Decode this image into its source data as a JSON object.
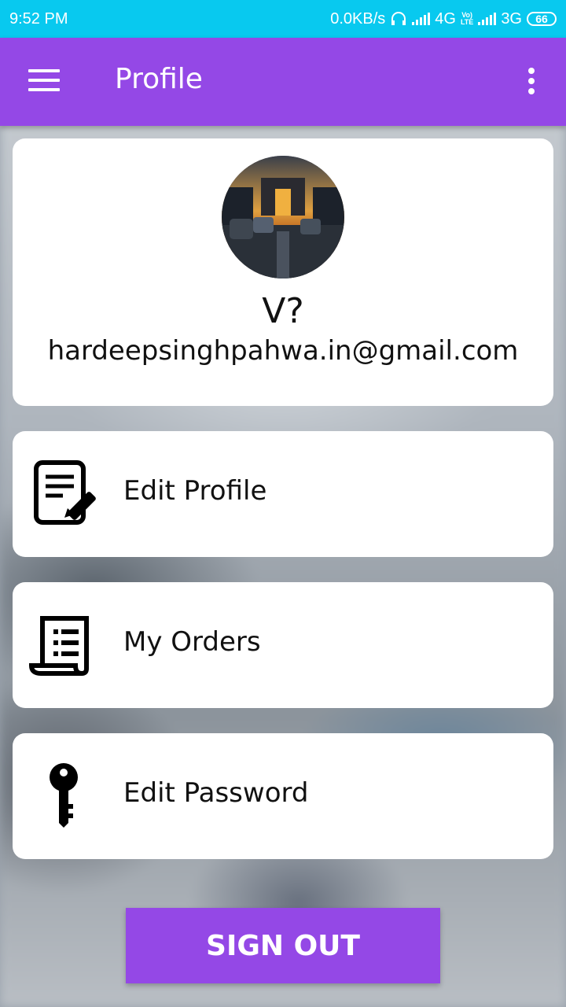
{
  "status_bar": {
    "time": "9:52 PM",
    "net_speed": "0.0KB/s",
    "network1": "4G",
    "volte_top": "Vo)",
    "volte_bottom": "LTE",
    "network2": "3G",
    "battery": "66"
  },
  "app_bar": {
    "title": "Profile",
    "menu_icon": "hamburger-menu-icon",
    "overflow_icon": "more-vert-icon"
  },
  "profile": {
    "name": "V?",
    "email": "hardeepsinghpahwa.in@gmail.com"
  },
  "menu": [
    {
      "label": "Edit Profile",
      "icon": "edit-document-icon"
    },
    {
      "label": "My Orders",
      "icon": "receipt-list-icon"
    },
    {
      "label": "Edit Password",
      "icon": "key-icon"
    }
  ],
  "sign_out_label": "SIGN OUT",
  "colors": {
    "status_bar": "#08c9ef",
    "app_bar": "#9448e6",
    "button": "#9448e6"
  }
}
